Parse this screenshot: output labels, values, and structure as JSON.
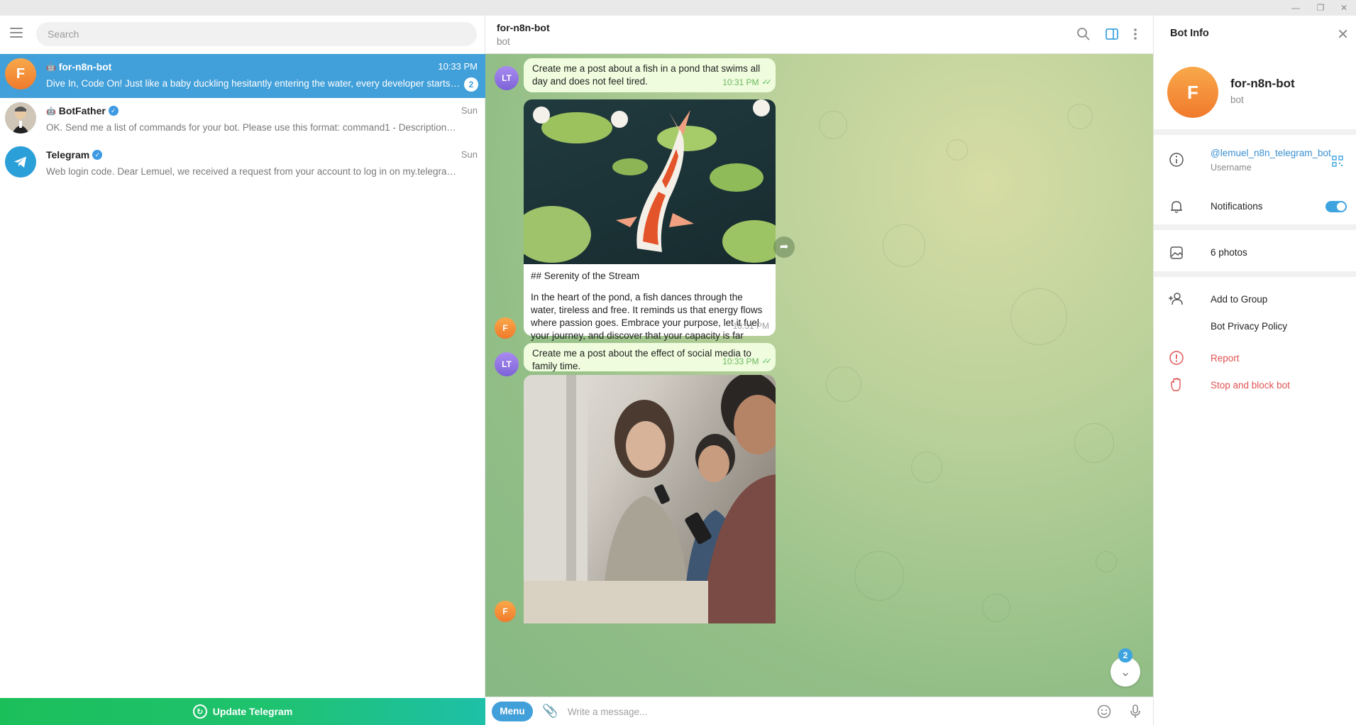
{
  "sidebar": {
    "search_placeholder": "Search",
    "chats": [
      {
        "name": "for-n8n-bot",
        "avatar_letter": "F",
        "time": "10:33 PM",
        "preview": "Dive In, Code On!  Just like a baby duckling hesitantly entering the water, every developer starts s...",
        "unread": "2",
        "is_bot": true
      },
      {
        "name": "BotFather",
        "time": "Sun",
        "preview": "OK. Send me a list of commands for your bot. Please use this format:  command1 - Description comm...",
        "verified": true,
        "is_bot": true
      },
      {
        "name": "Telegram",
        "time": "Sun",
        "preview": "Web login code. Dear Lemuel, we received a request from your account to log in on my.telegram.org. ...",
        "verified": true
      }
    ],
    "update_label": "Update Telegram"
  },
  "chat": {
    "title": "for-n8n-bot",
    "subtitle": "bot",
    "messages": [
      {
        "sender_initials": "LT",
        "text": "Create me a post about a fish in a pond that swims all day and does not feel tired.",
        "time": "10:31 PM"
      },
      {
        "sender_initials": "F",
        "heading": "## Serenity of the Stream",
        "text": "In the heart of the pond, a fish dances through the water, tireless and free. It reminds us that energy flows where passion goes. Embrace your purpose, let it fuel your journey, and discover that your capacity is far greater than you ever imagined.",
        "time": "10:31 PM"
      },
      {
        "sender_initials": "LT",
        "text": "Create me a post about the effect of social media to family time.",
        "time": "10:33 PM"
      }
    ],
    "scroll_badge": "2",
    "menu_label": "Menu",
    "input_placeholder": "Write a message..."
  },
  "info_panel": {
    "title": "Bot Info",
    "name": "for-n8n-bot",
    "subtitle": "bot",
    "avatar_letter": "F",
    "username": "@lemuel_n8n_telegram_bot",
    "username_label": "Username",
    "notifications_label": "Notifications",
    "notifications_on": true,
    "photos_label": "6 photos",
    "add_to_group_label": "Add to Group",
    "privacy_label": "Bot Privacy Policy",
    "report_label": "Report",
    "stop_label": "Stop and block bot"
  },
  "colors": {
    "accent": "#419fd9",
    "outgoing_bubble": "#effdde",
    "danger": "#e05352",
    "update_green": "#1fc26e"
  }
}
